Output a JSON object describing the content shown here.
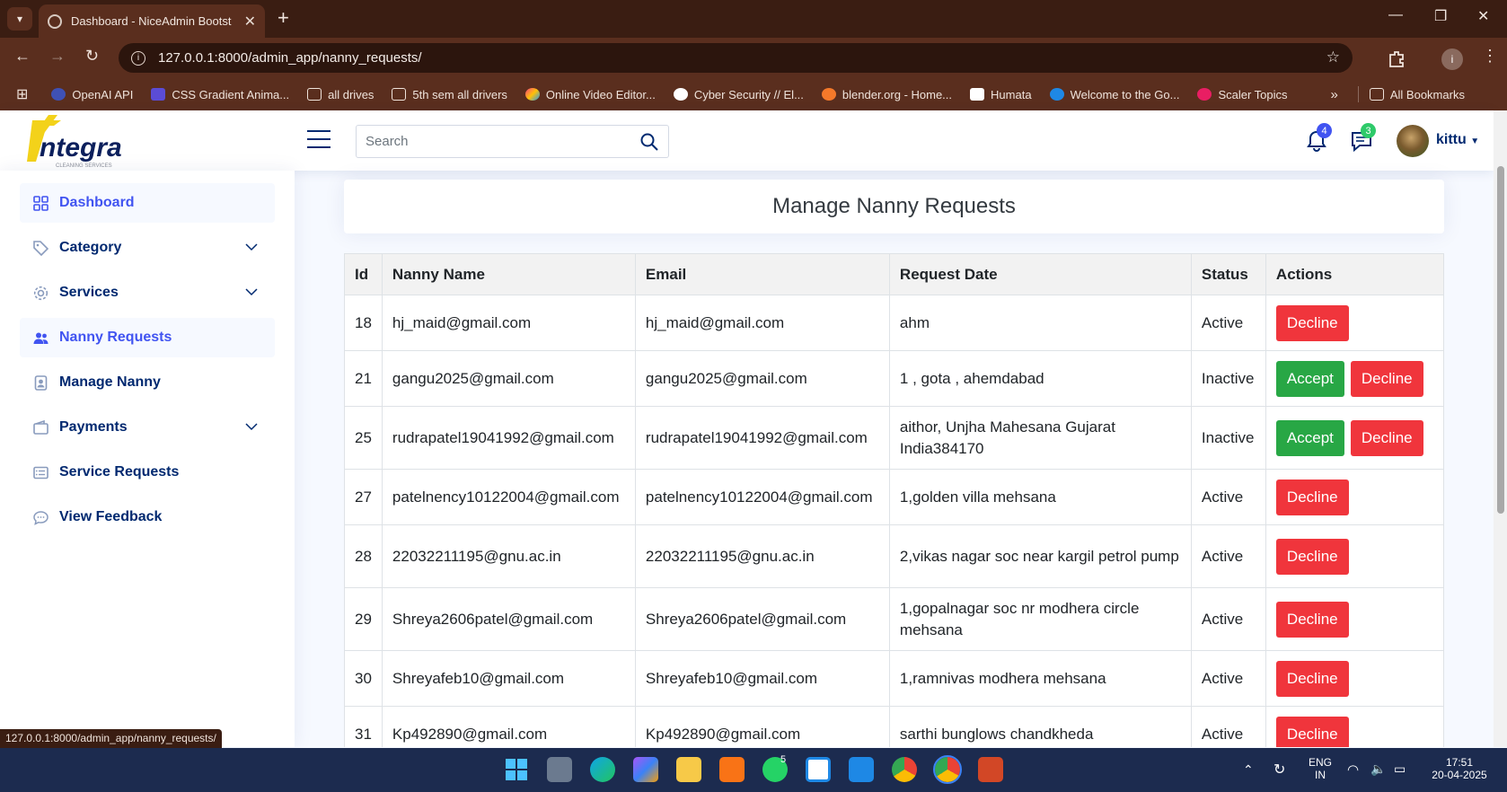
{
  "browser": {
    "tab_title": "Dashboard - NiceAdmin Bootst",
    "url": "127.0.0.1:8000/admin_app/nanny_requests/",
    "bookmarks": [
      "OpenAI API",
      "CSS Gradient Anima...",
      "all drives",
      "5th sem all drivers",
      "Online Video Editor...",
      "Cyber Security // El...",
      "blender.org - Home...",
      "Humata",
      "Welcome to the Go...",
      "Scaler Topics"
    ],
    "all_bookmarks": "All Bookmarks",
    "status_url": "127.0.0.1:8000/admin_app/nanny_requests/"
  },
  "header": {
    "logo_text": "ntegra",
    "logo_sub": "CLEANING    SERVICES",
    "search_placeholder": "Search",
    "notifications_count": "4",
    "messages_count": "3",
    "user_name": "kittu"
  },
  "sidebar": {
    "items": [
      {
        "label": "Dashboard",
        "icon": "grid-icon"
      },
      {
        "label": "Category",
        "icon": "tag-icon"
      },
      {
        "label": "Services",
        "icon": "gear-icon"
      },
      {
        "label": "Nanny Requests",
        "icon": "people-icon"
      },
      {
        "label": "Manage Nanny",
        "icon": "person-badge-icon"
      },
      {
        "label": "Payments",
        "icon": "wallet-icon"
      },
      {
        "label": "Service Requests",
        "icon": "card-list-icon"
      },
      {
        "label": "View Feedback",
        "icon": "chat-icon"
      }
    ]
  },
  "main": {
    "page_title": "Manage Nanny Requests",
    "columns": [
      "Id",
      "Nanny Name",
      "Email",
      "Request Date",
      "Status",
      "Actions"
    ],
    "accept_label": "Accept",
    "decline_label": "Decline",
    "rows": [
      {
        "id": "18",
        "name": "hj_maid@gmail.com",
        "email": "hj_maid@gmail.com",
        "request_date": "ahm",
        "status": "Active"
      },
      {
        "id": "21",
        "name": "gangu2025@gmail.com",
        "email": "gangu2025@gmail.com",
        "request_date": "1 , gota , ahemdabad",
        "status": "Inactive"
      },
      {
        "id": "25",
        "name": "rudrapatel19041992@gmail.com",
        "email": "rudrapatel19041992@gmail.com",
        "request_date": "aithor, Unjha Mahesana Gujarat India384170",
        "status": "Inactive"
      },
      {
        "id": "27",
        "name": "patelnency10122004@gmail.com",
        "email": "patelnency10122004@gmail.com",
        "request_date": "1,golden villa mehsana",
        "status": "Active"
      },
      {
        "id": "28",
        "name": "22032211195@gnu.ac.in",
        "email": "22032211195@gnu.ac.in",
        "request_date": "2,vikas nagar soc near kargil petrol pump",
        "status": "Active"
      },
      {
        "id": "29",
        "name": "Shreya2606patel@gmail.com",
        "email": "Shreya2606patel@gmail.com",
        "request_date": "1,gopalnagar soc nr modhera circle mehsana",
        "status": "Active"
      },
      {
        "id": "30",
        "name": "Shreyafeb10@gmail.com",
        "email": "Shreyafeb10@gmail.com",
        "request_date": "1,ramnivas modhera mehsana",
        "status": "Active"
      },
      {
        "id": "31",
        "name": "Kp492890@gmail.com",
        "email": "Kp492890@gmail.com",
        "request_date": "sarthi bunglows chandkheda",
        "status": "Active"
      }
    ]
  },
  "taskbar": {
    "language": "ENG",
    "region": "IN",
    "time": "17:51",
    "date": "20-04-2025",
    "whatsapp_badge": "5"
  },
  "colors": {
    "accept": "#28a745",
    "decline": "#f0353c",
    "nav_text": "#012970",
    "nav_active": "#4154f1",
    "browser_chrome": "#5a2e1e"
  }
}
